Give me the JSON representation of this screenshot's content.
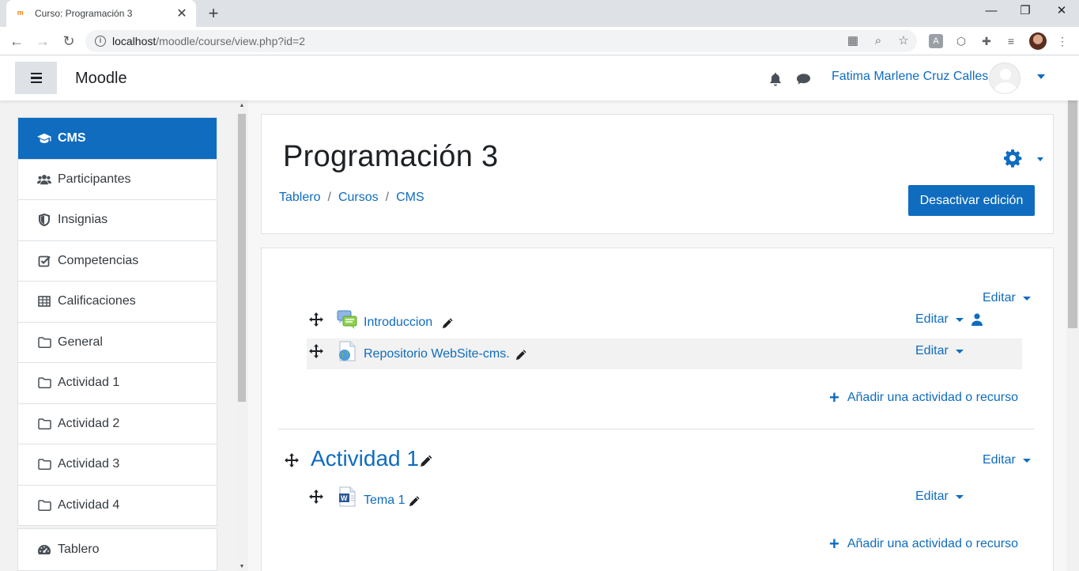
{
  "browser": {
    "tab_title": "Curso: Programación 3",
    "tab_favicon": "moodle-favicon",
    "url_host": "localhost",
    "url_path": "/moodle/course/view.php?id=2",
    "new_tab_label": "+"
  },
  "navbar": {
    "brand": "Moodle",
    "user_name": "Fatima Marlene Cruz Calles"
  },
  "drawer": {
    "items": [
      {
        "label": "CMS",
        "icon": "graduation-cap-icon",
        "active": true
      },
      {
        "label": "Participantes",
        "icon": "users-icon"
      },
      {
        "label": "Insignias",
        "icon": "shield-icon"
      },
      {
        "label": "Competencias",
        "icon": "checkbox-icon"
      },
      {
        "label": "Calificaciones",
        "icon": "table-icon"
      },
      {
        "label": "General",
        "icon": "folder-icon"
      },
      {
        "label": "Actividad 1",
        "icon": "folder-icon"
      },
      {
        "label": "Actividad 2",
        "icon": "folder-icon"
      },
      {
        "label": "Actividad 3",
        "icon": "folder-icon"
      },
      {
        "label": "Actividad 4",
        "icon": "folder-icon"
      }
    ],
    "secondary": [
      {
        "label": "Tablero",
        "icon": "dashboard-icon"
      }
    ]
  },
  "header": {
    "title": "Programación 3",
    "breadcrumb": [
      "Tablero",
      "Cursos",
      "CMS"
    ],
    "breadcrumb_separator": "/",
    "edit_mode_button": "Desactivar edición"
  },
  "course": {
    "edit_label": "Editar",
    "add_activity_label": "Añadir una actividad o recurso",
    "section0": {
      "activities": [
        {
          "name": "Introduccion",
          "icon": "forum-icon"
        },
        {
          "name": "Repositorio WebSite-cms.",
          "icon": "url-globe-icon"
        }
      ]
    },
    "section1": {
      "title": "Actividad 1",
      "activities": [
        {
          "name": "Tema 1",
          "icon": "word-doc-icon"
        }
      ]
    }
  },
  "colors": {
    "primary": "#0f6cbf",
    "drawer_bg": "#f2f2f2",
    "text": "#343a40"
  }
}
